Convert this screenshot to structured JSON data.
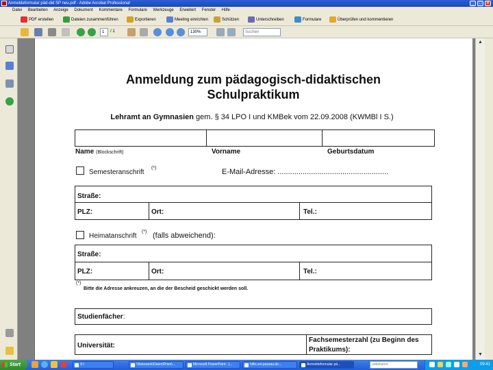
{
  "window": {
    "title": "Anmeldeformular päd-did SP neu.pdf - Adobe Acrobat Professional",
    "min": "_",
    "max": "□",
    "close": "✕"
  },
  "menu": [
    "Datei",
    "Bearbeiten",
    "Anzeige",
    "Dokument",
    "Kommentare",
    "Formulare",
    "Werkzeuge",
    "Erweitert",
    "Fenster",
    "Hilfe"
  ],
  "toolbar1": {
    "create_pdf": "PDF erstellen",
    "combine": "Dateien zusammenführen",
    "export": "Exportieren",
    "meeting": "Meeting einrichten",
    "secure": "Schützen",
    "sign": "Unterschreiben",
    "forms": "Formulare",
    "review": "Überprüfen und kommentieren"
  },
  "toolbar2": {
    "page_number": "1",
    "page_total": "/ 1",
    "zoom": "130%",
    "search_placeholder": "Suchen"
  },
  "document": {
    "title_line1": "Anmeldung zum pädagogisch-didaktischen",
    "title_line2": "Schulpraktikum",
    "subtitle_bold": "Lehramt an Gymnasien",
    "subtitle_rest": " gem. § 34 LPO I und KMBek vom 22.09.2008 (KWMBl I S.)",
    "name_label": "Name",
    "name_hint": "(Blockschrift)",
    "vorname_label": "Vorname",
    "geburtsdatum_label": "Geburtsdatum",
    "semesteranschrift_label": "Semesteranschrift",
    "star": "(*)",
    "email_label": "E-Mail-Adresse: .....................................................",
    "strasse_label": "Straße:",
    "plz_label": "PLZ:",
    "ort_label": "Ort:",
    "tel_label": "Tel.:",
    "heimatanschrift_label": "Heimatanschrift",
    "heimat_suffix": "(falls abweichend):",
    "footnote_marker": "(*)",
    "footnote": "Bitte die Adresse ankreuzen, an die der Bescheid geschickt werden soll.",
    "studienfaecher_label": "Studienfächer",
    "studienfaecher_colon": ":",
    "universitaet_label": "Universität:",
    "fachsemester_line1": "Fachsemesterzahl (zu Beginn des",
    "fachsemester_line2": "Praktikums):"
  },
  "taskbar": {
    "start": "Start",
    "tasks": [
      "S:\\",
      "\\\\Netzwerk\\Daten\\Prien\\...",
      "Microsoft PowerPoint - [...",
      "hilfe.uni-passau.de...",
      "Anmeldeformular pä..."
    ],
    "tray_text": "unbekannt",
    "clock": "09:41"
  },
  "icons": [
    "acrobat-icon",
    "open-icon",
    "save-icon",
    "print-icon",
    "email-icon",
    "prev-page-icon",
    "next-page-icon",
    "hand-tool-icon",
    "select-tool-icon",
    "zoom-in-icon",
    "zoom-out-icon",
    "pages-icon",
    "bookmarks-icon",
    "signatures-icon",
    "help-icon",
    "attachments-icon",
    "comments-icon"
  ]
}
